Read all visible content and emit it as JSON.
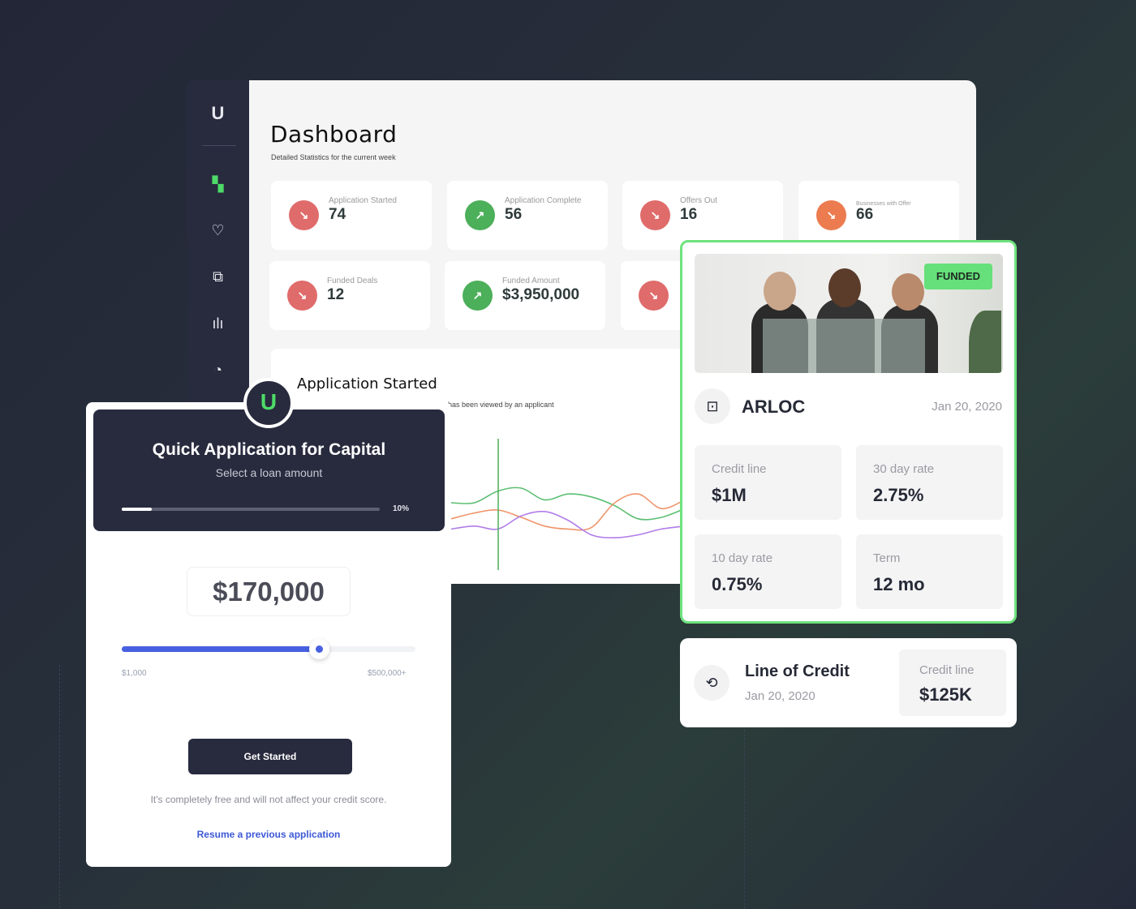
{
  "sidebar": {
    "logo": "U",
    "items": [
      {
        "icon": "grid-icon",
        "active": true
      },
      {
        "icon": "heart-handshake-icon"
      },
      {
        "icon": "copy-icon"
      },
      {
        "icon": "bar-chart-icon"
      },
      {
        "icon": "pie-chart-icon"
      }
    ]
  },
  "dashboard": {
    "title": "Dashboard",
    "subtitle": "Detailed Statistics for the current week",
    "stats": [
      {
        "label": "Application Started",
        "value": "74",
        "trend": "down",
        "color": "#e06b6b"
      },
      {
        "label": "Application Complete",
        "value": "56",
        "trend": "up",
        "color": "#4caf5a"
      },
      {
        "label": "Offers Out",
        "value": "16",
        "trend": "down",
        "color": "#e06b6b"
      },
      {
        "label": "Businesses with Offer",
        "value": "66",
        "trend": "down",
        "color": "#ec7b50"
      },
      {
        "label": "Funded Deals",
        "value": "12",
        "trend": "down",
        "color": "#e06b6b"
      },
      {
        "label": "Funded Amount",
        "value": "$3,950,000",
        "trend": "up",
        "color": "#4caf5a"
      },
      {
        "label": "",
        "value": "",
        "trend": "down",
        "color": "#e06b6b"
      }
    ]
  },
  "chart": {
    "title": "Application Started",
    "subtitle": "has been viewed by an applicant",
    "series": [
      {
        "color": "#5cbf72",
        "values": [
          50,
          50,
          42,
          40,
          48,
          44,
          46,
          52,
          61,
          60,
          54
        ]
      },
      {
        "color": "#f0956a",
        "values": [
          61,
          57,
          55,
          60,
          66,
          68,
          67,
          50,
          44,
          54,
          48
        ]
      },
      {
        "color": "#b07ce8",
        "values": [
          68,
          66,
          68,
          59,
          56,
          62,
          72,
          74,
          72,
          68,
          66
        ]
      }
    ]
  },
  "quick": {
    "title": "Quick Application for Capital",
    "subtitle": "Select a loan amount",
    "progress_label": "10%",
    "progress": 0.1,
    "amount": "$170,000",
    "slider_min": "$1,000",
    "slider_max": "$500,000+",
    "slider_fraction": 0.67,
    "button": "Get Started",
    "note": "It's completely free and will not affect your credit score.",
    "link": "Resume a previous application"
  },
  "funded": {
    "badge": "FUNDED",
    "name": "ARLOC",
    "date": "Jan 20, 2020",
    "tiles": [
      {
        "label": "Credit line",
        "value": "$1M"
      },
      {
        "label": "30 day rate",
        "value": "2.75%"
      },
      {
        "label": "10 day rate",
        "value": "0.75%"
      },
      {
        "label": "Term",
        "value": "12 mo"
      }
    ]
  },
  "loc": {
    "name": "Line of Credit",
    "date": "Jan 20, 2020",
    "label": "Credit line",
    "value": "$125K"
  }
}
